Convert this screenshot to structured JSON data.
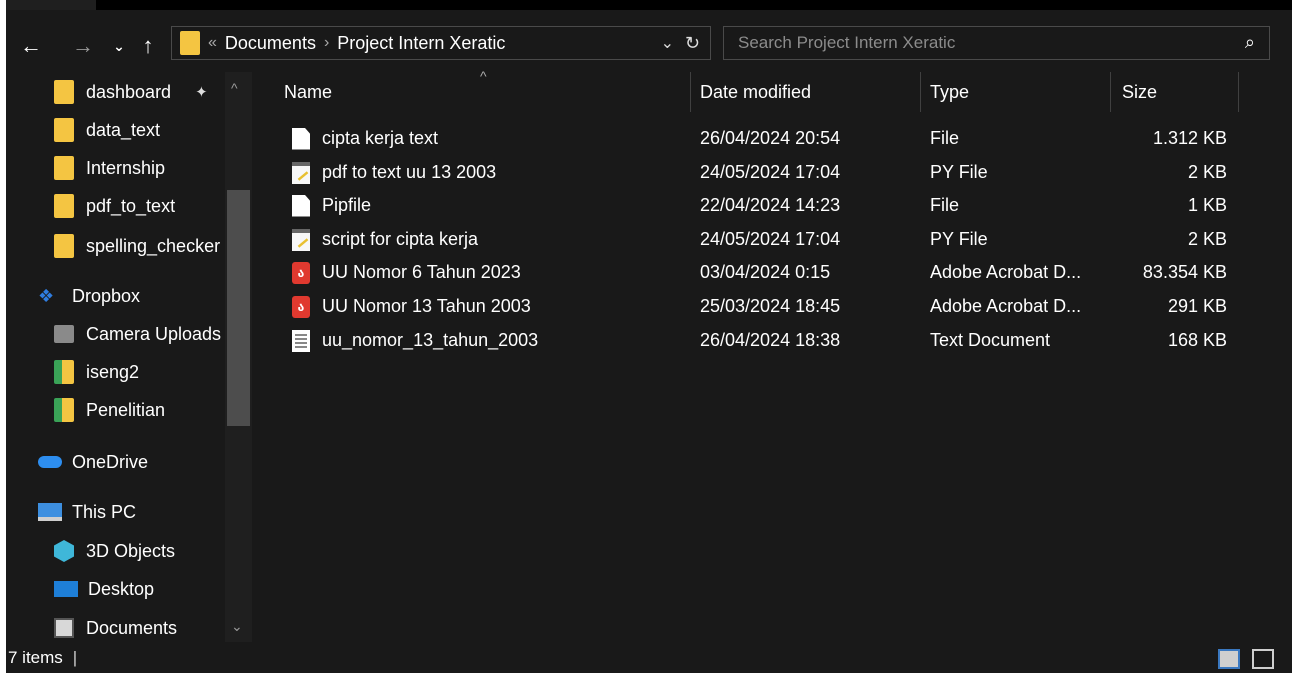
{
  "address": {
    "overflow_chevron": "«",
    "crumbs": [
      "Documents",
      "Project Intern Xeratic"
    ],
    "separator": "›"
  },
  "search": {
    "placeholder": "Search Project Intern Xeratic"
  },
  "sidebar": {
    "items": [
      {
        "label": "dashboard",
        "icon": "folder-icon",
        "pinned": true
      },
      {
        "label": "data_text",
        "icon": "folder-icon"
      },
      {
        "label": "Internship",
        "icon": "folder-icon"
      },
      {
        "label": "pdf_to_text",
        "icon": "folder-icon"
      },
      {
        "label": "spelling_checker",
        "icon": "folder-icon"
      },
      {
        "label": "Dropbox",
        "icon": "dropbox-icon"
      },
      {
        "label": "Camera Uploads",
        "icon": "camera-folder-icon"
      },
      {
        "label": "iseng2",
        "icon": "synced-folder-icon"
      },
      {
        "label": "Penelitian",
        "icon": "synced-folder-icon"
      },
      {
        "label": "OneDrive",
        "icon": "onedrive-icon"
      },
      {
        "label": "This PC",
        "icon": "pc-icon"
      },
      {
        "label": "3D Objects",
        "icon": "3d-objects-icon"
      },
      {
        "label": "Desktop",
        "icon": "desktop-icon"
      },
      {
        "label": "Documents",
        "icon": "documents-icon"
      }
    ]
  },
  "columns": {
    "name": "Name",
    "date": "Date modified",
    "type": "Type",
    "size": "Size"
  },
  "files": [
    {
      "name": "cipta kerja text",
      "date": "26/04/2024 20:54",
      "type": "File",
      "size": "1.312 KB",
      "icon": "file-icon"
    },
    {
      "name": "pdf to text uu 13 2003",
      "date": "24/05/2024 17:04",
      "type": "PY File",
      "size": "2 KB",
      "icon": "python-file-icon"
    },
    {
      "name": "Pipfile",
      "date": "22/04/2024 14:23",
      "type": "File",
      "size": "1 KB",
      "icon": "file-icon"
    },
    {
      "name": "script for cipta kerja",
      "date": "24/05/2024 17:04",
      "type": "PY File",
      "size": "2 KB",
      "icon": "python-file-icon"
    },
    {
      "name": "UU Nomor 6 Tahun 2023",
      "date": "03/04/2024 0:15",
      "type": "Adobe Acrobat D...",
      "size": "83.354 KB",
      "icon": "pdf-file-icon"
    },
    {
      "name": "UU Nomor 13 Tahun 2003",
      "date": "25/03/2024 18:45",
      "type": "Adobe Acrobat D...",
      "size": "291 KB",
      "icon": "pdf-file-icon"
    },
    {
      "name": "uu_nomor_13_tahun_2003",
      "date": "26/04/2024 18:38",
      "type": "Text Document",
      "size": "168 KB",
      "icon": "text-file-icon"
    }
  ],
  "status": {
    "count": "7 items"
  },
  "colors": {
    "background": "#191919",
    "folder": "#f4c542",
    "pdf": "#e0392f",
    "dropbox": "#2f7de0",
    "onedrive": "#2d8ef0"
  }
}
